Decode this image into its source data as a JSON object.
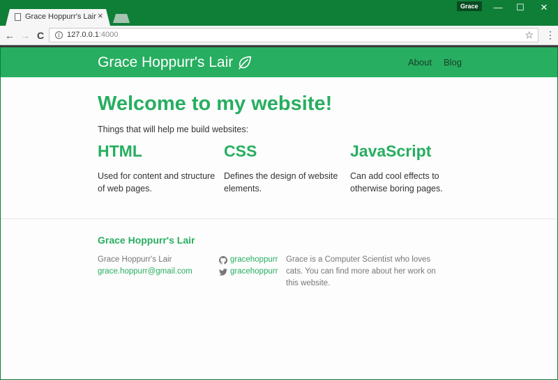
{
  "browser": {
    "tab_title": "Grace Hoppurr's Lair",
    "tab_close": "×",
    "profile_name": "Grace",
    "window_controls": {
      "minimize": "—",
      "maximize": "☐",
      "close": "✕"
    },
    "back": "←",
    "forward": "→",
    "reload": "C",
    "url_host": "127.0.0.1",
    "url_port": ":4000",
    "bookmark": "☆",
    "menu": "⋮",
    "info": "i"
  },
  "nav": {
    "brand": "Grace Hoppurr's Lair",
    "links": [
      "About",
      "Blog"
    ]
  },
  "hero": {
    "title": "Welcome to my website!",
    "subtitle": "Things that will help me build websites:"
  },
  "features": [
    {
      "title": "HTML",
      "text": "Used for content and structure of web pages."
    },
    {
      "title": "CSS",
      "text": "Defines the design of website elements."
    },
    {
      "title": "JavaScript",
      "text": "Can add cool effects to otherwise boring pages."
    }
  ],
  "footer": {
    "title": "Grace Hoppurr's Lair",
    "name": "Grace Hoppurr's Lair",
    "email": "grace.hoppurr@gmail.com",
    "github": "gracehoppurr",
    "twitter": "gracehoppurr",
    "description": "Grace is a Computer Scientist who loves cats. You can find more about her work on this website."
  },
  "colors": {
    "accent": "#27ae60",
    "window": "#0f7f38"
  }
}
